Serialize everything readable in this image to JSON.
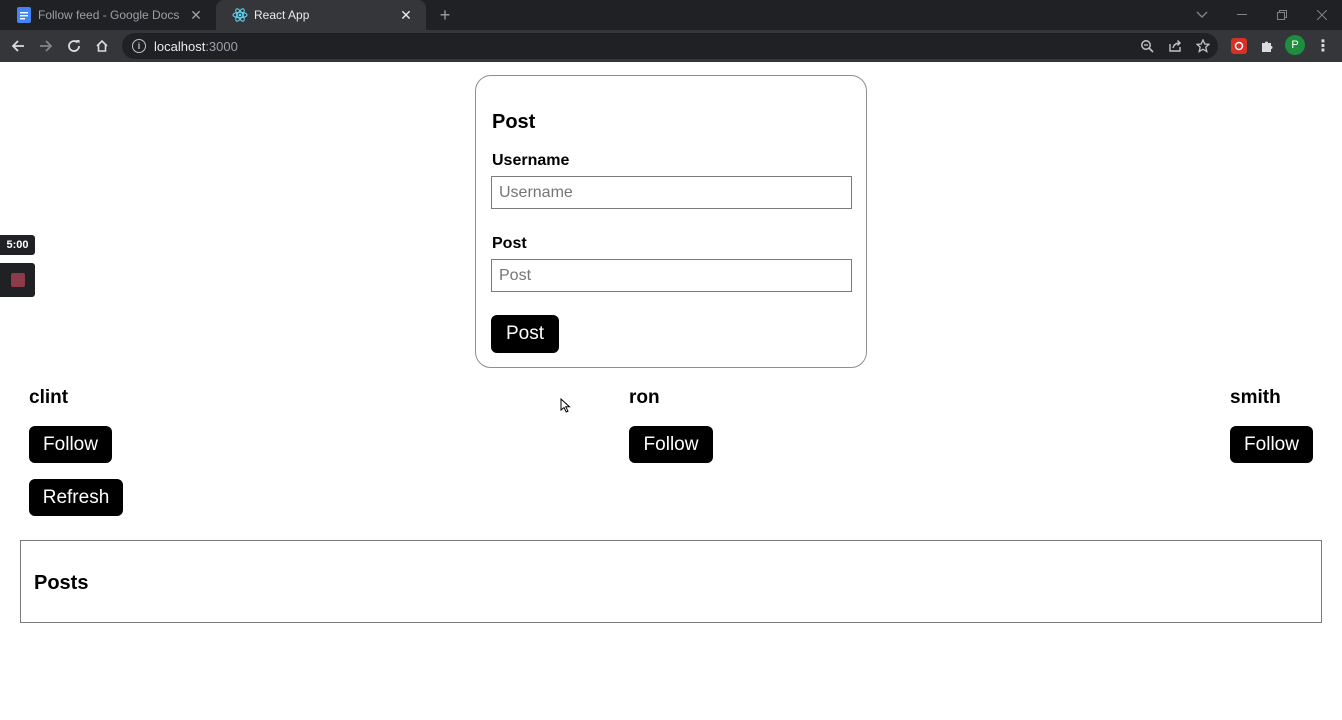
{
  "browser": {
    "tabs": [
      {
        "title": "Follow feed - Google Docs",
        "active": false
      },
      {
        "title": "React App",
        "active": true
      }
    ],
    "url_host": "localhost",
    "url_port": ":3000",
    "profile_initial": "P"
  },
  "form": {
    "heading": "Post",
    "username_label": "Username",
    "username_placeholder": "Username",
    "username_value": "",
    "post_label": "Post",
    "post_placeholder": "Post",
    "post_value": "",
    "submit_label": "Post"
  },
  "users": [
    {
      "name": "clint",
      "follow_label": "Follow"
    },
    {
      "name": "ron",
      "follow_label": "Follow"
    },
    {
      "name": "smith",
      "follow_label": "Follow"
    }
  ],
  "refresh_label": "Refresh",
  "posts_heading": "Posts",
  "recorder": {
    "timer": "5:00"
  },
  "colors": {
    "button_bg": "#000000",
    "button_text": "#ffffff",
    "chrome_dark": "#202124",
    "chrome_toolbar": "#35363a",
    "profile": "#1e8e3e"
  }
}
